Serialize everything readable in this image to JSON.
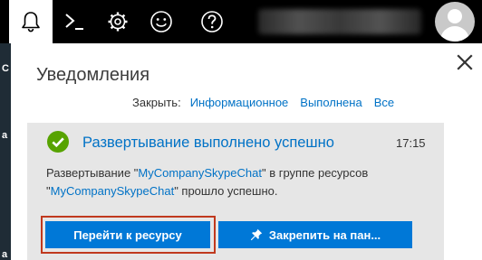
{
  "topbar": {
    "icons": [
      "bell-icon",
      "terminal-icon",
      "gear-icon",
      "smiley-icon",
      "help-icon"
    ],
    "active_icon": "bell-icon",
    "background": "#000000",
    "avatar_icon": "user-avatar-icon"
  },
  "leftstrip": {
    "letters": [
      "C",
      "a",
      "a"
    ]
  },
  "panel": {
    "title": "Уведомления",
    "close_icon": "close-icon",
    "dismiss": {
      "label": "Закрыть:",
      "links": [
        "Информационное",
        "Выполнена",
        "Все"
      ]
    }
  },
  "notification": {
    "status_icon": "check-circle-icon",
    "title": "Развертывание выполнено успешно",
    "time": "17:15",
    "message": {
      "part1": "Развертывание \"",
      "resource1": "MyCompanySkypeChat",
      "part2": "\" в группе ресурсов",
      "part3": "\"",
      "resource2": "MyCompanySkypeChat",
      "part4": "\" прошло успешно."
    },
    "buttons": {
      "goto_label": "Перейти к ресурсу",
      "pin_label": "Закрепить на пан..."
    }
  },
  "colors": {
    "accent": "#0078d7",
    "link": "#0072c6",
    "success": "#57a300",
    "highlight": "#c0391e"
  }
}
